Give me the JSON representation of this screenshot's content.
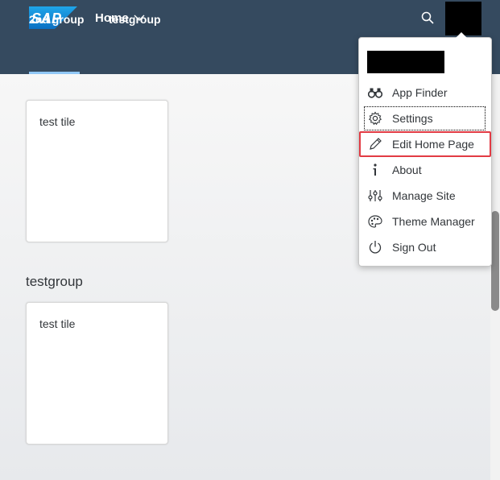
{
  "header": {
    "logo_text": "SAP",
    "home_label": "Home",
    "colors": {
      "shell_bg": "#354a5f",
      "logo_blue": "#1c8fd6",
      "tab_indicator": "#91c8f6"
    }
  },
  "tabs": [
    {
      "label": "2nd group",
      "active": true
    },
    {
      "label": "testgroup",
      "active": false
    }
  ],
  "groups": [
    {
      "title": "",
      "tiles": [
        {
          "title": "test tile"
        }
      ]
    },
    {
      "title": "testgroup",
      "tiles": [
        {
          "title": "test tile"
        }
      ]
    }
  ],
  "user_menu": {
    "items": [
      {
        "label": "App Finder",
        "icon": "binoculars-icon"
      },
      {
        "label": "Settings",
        "icon": "gear-icon"
      },
      {
        "label": "Edit Home Page",
        "icon": "pencil-icon"
      },
      {
        "label": "About",
        "icon": "info-icon"
      },
      {
        "label": "Manage Site",
        "icon": "sliders-icon"
      },
      {
        "label": "Theme Manager",
        "icon": "palette-icon"
      },
      {
        "label": "Sign Out",
        "icon": "power-icon"
      }
    ],
    "highlight_color": "#e23b44"
  }
}
